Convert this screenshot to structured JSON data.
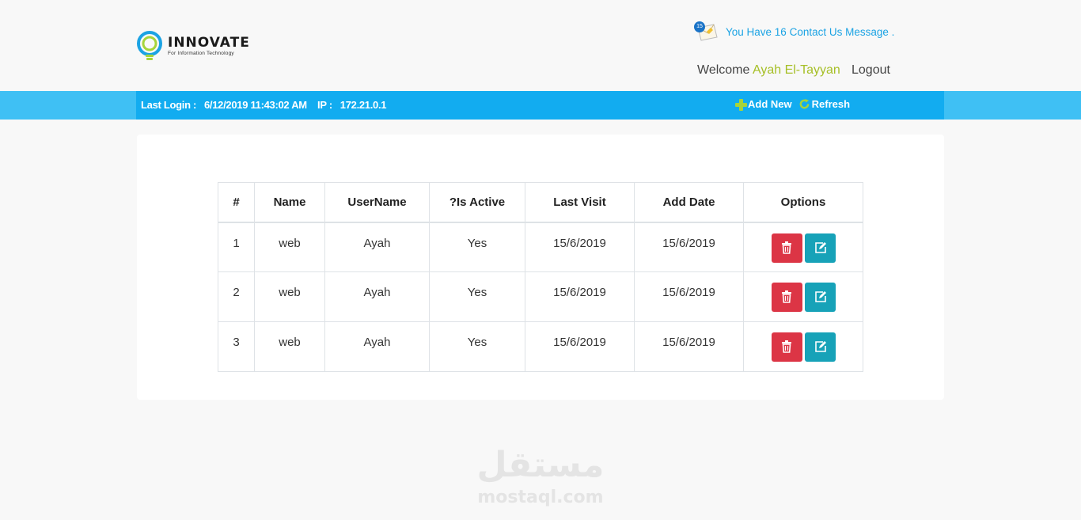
{
  "header": {
    "logo_name": "INNOVATE",
    "logo_sub": "For Information Technology",
    "message_count": "15",
    "message_text": "You Have 16 Contact Us Message .",
    "welcome_label": "Welcome",
    "user_name": "Ayah El-Tayyan",
    "logout_label": "Logout"
  },
  "bar": {
    "login_text": "Last Login :   6/12/2019 11:43:02 AM    IP :   172.21.0.1",
    "add_new_label": "Add New",
    "refresh_label": "Refresh"
  },
  "table": {
    "columns": [
      "#",
      "Name",
      "UserName",
      "?Is Active",
      "Last Visit",
      "Add Date",
      "Options"
    ],
    "rows": [
      [
        "1",
        "web",
        "Ayah",
        "Yes",
        "15/6/2019",
        "15/6/2019"
      ],
      [
        "2",
        "web",
        "Ayah",
        "Yes",
        "15/6/2019",
        "15/6/2019"
      ],
      [
        "3",
        "web",
        "Ayah",
        "Yes",
        "15/6/2019",
        "15/6/2019"
      ]
    ]
  },
  "watermark": {
    "arabic": "مستقل",
    "latin": "mostaql.com"
  },
  "colors": {
    "accent_blue": "#12acf0",
    "bar_outer": "#3fc0f4",
    "user_green": "#a6bf26",
    "delete_red": "#dc3545",
    "edit_teal": "#17a2b8",
    "message_blue": "#1ba3e4"
  },
  "icons": {
    "logo": "lightbulb-icon",
    "message": "envelope-icon",
    "add": "plus-icon",
    "refresh": "refresh-icon",
    "delete": "trash-icon",
    "edit": "edit-icon"
  }
}
